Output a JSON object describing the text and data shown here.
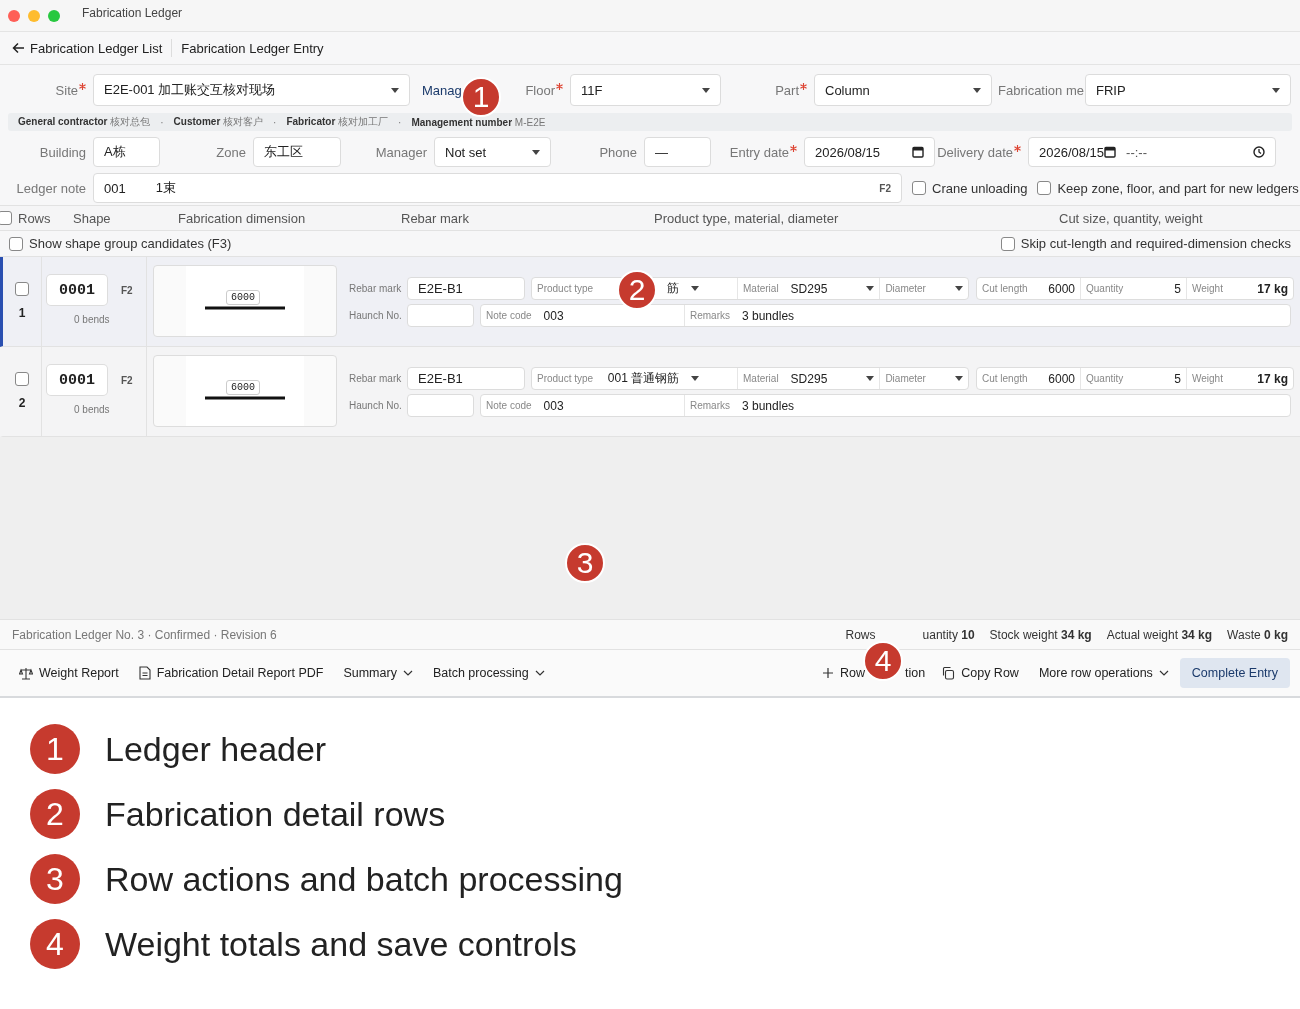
{
  "window": {
    "title": "Fabrication Ledger"
  },
  "breadcrumb": {
    "back": "Fabrication Ledger List",
    "current": "Fabrication Ledger Entry"
  },
  "header": {
    "site": {
      "label": "Site",
      "required": true,
      "value": "E2E-001 加工账交互核对现场"
    },
    "manage_link": "Manag",
    "floor": {
      "label": "Floor",
      "required": true,
      "value": "11F"
    },
    "part": {
      "label": "Part",
      "required": true,
      "value": "Column"
    },
    "fabrication_method": {
      "label": "Fabrication me",
      "required": false,
      "value": "FRIP"
    },
    "parties": [
      {
        "label": "General contractor",
        "value": "核对总包"
      },
      {
        "separator": "·",
        "label": "Customer",
        "value": "核对客户"
      },
      {
        "separator": "·",
        "label": "Fabricator",
        "value": "核对加工厂"
      },
      {
        "separator": "·",
        "label": "Management number",
        "value": "M-E2E"
      }
    ],
    "building": {
      "label": "Building",
      "value": "A栋"
    },
    "zone": {
      "label": "Zone",
      "value": "东工区"
    },
    "manager": {
      "label": "Manager",
      "value": "Not set"
    },
    "phone": {
      "label": "Phone",
      "value": "—"
    },
    "entry_date": {
      "label": "Entry date",
      "required": true,
      "value": "2026/08/15"
    },
    "delivery_date": {
      "label": "Delivery date",
      "required": true,
      "value": "2026/08/15",
      "time": "--:--"
    },
    "ledger_note": {
      "label": "Ledger note",
      "values": [
        "001",
        "1束"
      ],
      "shortcut": "F2"
    },
    "checkboxes": [
      {
        "label": "Crane unloading",
        "checked": false
      },
      {
        "label": "Keep zone, floor, and part for new ledgers",
        "checked": false
      }
    ]
  },
  "table": {
    "select_all": {
      "label": "Rows",
      "checked": false
    },
    "columns": [
      "Shape",
      "Fabrication dimension",
      "Rebar mark",
      "Product type, material, diameter",
      "Cut size, quantity, weight"
    ],
    "options": [
      {
        "label": "Show shape group candidates (F3)",
        "checked": false
      },
      {
        "label": "Skip cut-length and required-dimension checks",
        "checked": false
      }
    ],
    "rows": [
      {
        "index": "1",
        "selected": true,
        "checked": false,
        "shape_code": "0001",
        "shortcut": "F2",
        "bends": "0 bends",
        "dimension": "6000",
        "rebar_mark": {
          "label": "Rebar mark",
          "value": "E2E-B1"
        },
        "product_type": {
          "label": "Product type",
          "value": "筋"
        },
        "material": {
          "label": "Material",
          "value": "SD295"
        },
        "diameter": {
          "label": "Diameter"
        },
        "cut_length": {
          "label": "Cut length",
          "value": "6000"
        },
        "quantity": {
          "label": "Quantity",
          "value": "5"
        },
        "weight": {
          "label": "Weight",
          "value": "17 kg"
        },
        "haunch_no": {
          "label": "Haunch No."
        },
        "note_code": {
          "label": "Note code",
          "value": "003"
        },
        "remarks": {
          "label": "Remarks",
          "value": "3 bundles"
        }
      },
      {
        "index": "2",
        "selected": false,
        "checked": false,
        "shape_code": "0001",
        "shortcut": "F2",
        "bends": "0 bends",
        "dimension": "6000",
        "rebar_mark": {
          "label": "Rebar mark",
          "value": "E2E-B1"
        },
        "product_type": {
          "label": "Product type",
          "value": "001 普通钢筋"
        },
        "material": {
          "label": "Material",
          "value": "SD295"
        },
        "diameter": {
          "label": "Diameter"
        },
        "cut_length": {
          "label": "Cut length",
          "value": "6000"
        },
        "quantity": {
          "label": "Quantity",
          "value": "5"
        },
        "weight": {
          "label": "Weight",
          "value": "17 kg"
        },
        "haunch_no": {
          "label": "Haunch No."
        },
        "note_code": {
          "label": "Note code",
          "value": "003"
        },
        "remarks": {
          "label": "Remarks",
          "value": "3 bundles"
        }
      }
    ]
  },
  "status_bar": {
    "summary": "Fabrication Ledger No. 3 · Confirmed · Revision 6",
    "totals": [
      {
        "label": "Rows"
      },
      {
        "label": "uantity",
        "value": "10"
      },
      {
        "label": "Stock weight",
        "value": "34 kg"
      },
      {
        "label": "Actual weight",
        "value": "34 kg"
      },
      {
        "label": "Waste",
        "value": "0 kg"
      }
    ]
  },
  "toolbar": {
    "left": [
      {
        "kind": "button",
        "label": "Weight Report"
      },
      {
        "kind": "button",
        "label": "Fabrication Detail Report PDF"
      },
      {
        "kind": "menu",
        "label": "Summary"
      },
      {
        "kind": "menu",
        "label": "Batch processing"
      }
    ],
    "right": [
      {
        "kind": "button",
        "label": "Row",
        "label_tail": "tion"
      },
      {
        "kind": "button",
        "label": "Copy Row"
      },
      {
        "kind": "menu",
        "label": "More row operations"
      },
      {
        "kind": "primary",
        "label": "Complete Entry"
      }
    ]
  },
  "callouts": [
    {
      "number": "1"
    },
    {
      "number": "2"
    },
    {
      "number": "3"
    },
    {
      "number": "4"
    }
  ],
  "legend": [
    {
      "number": "1",
      "text": "Ledger header"
    },
    {
      "number": "2",
      "text": "Fabrication detail rows"
    },
    {
      "number": "3",
      "text": "Row actions and batch processing"
    },
    {
      "number": "4",
      "text": "Weight totals and save controls"
    }
  ]
}
